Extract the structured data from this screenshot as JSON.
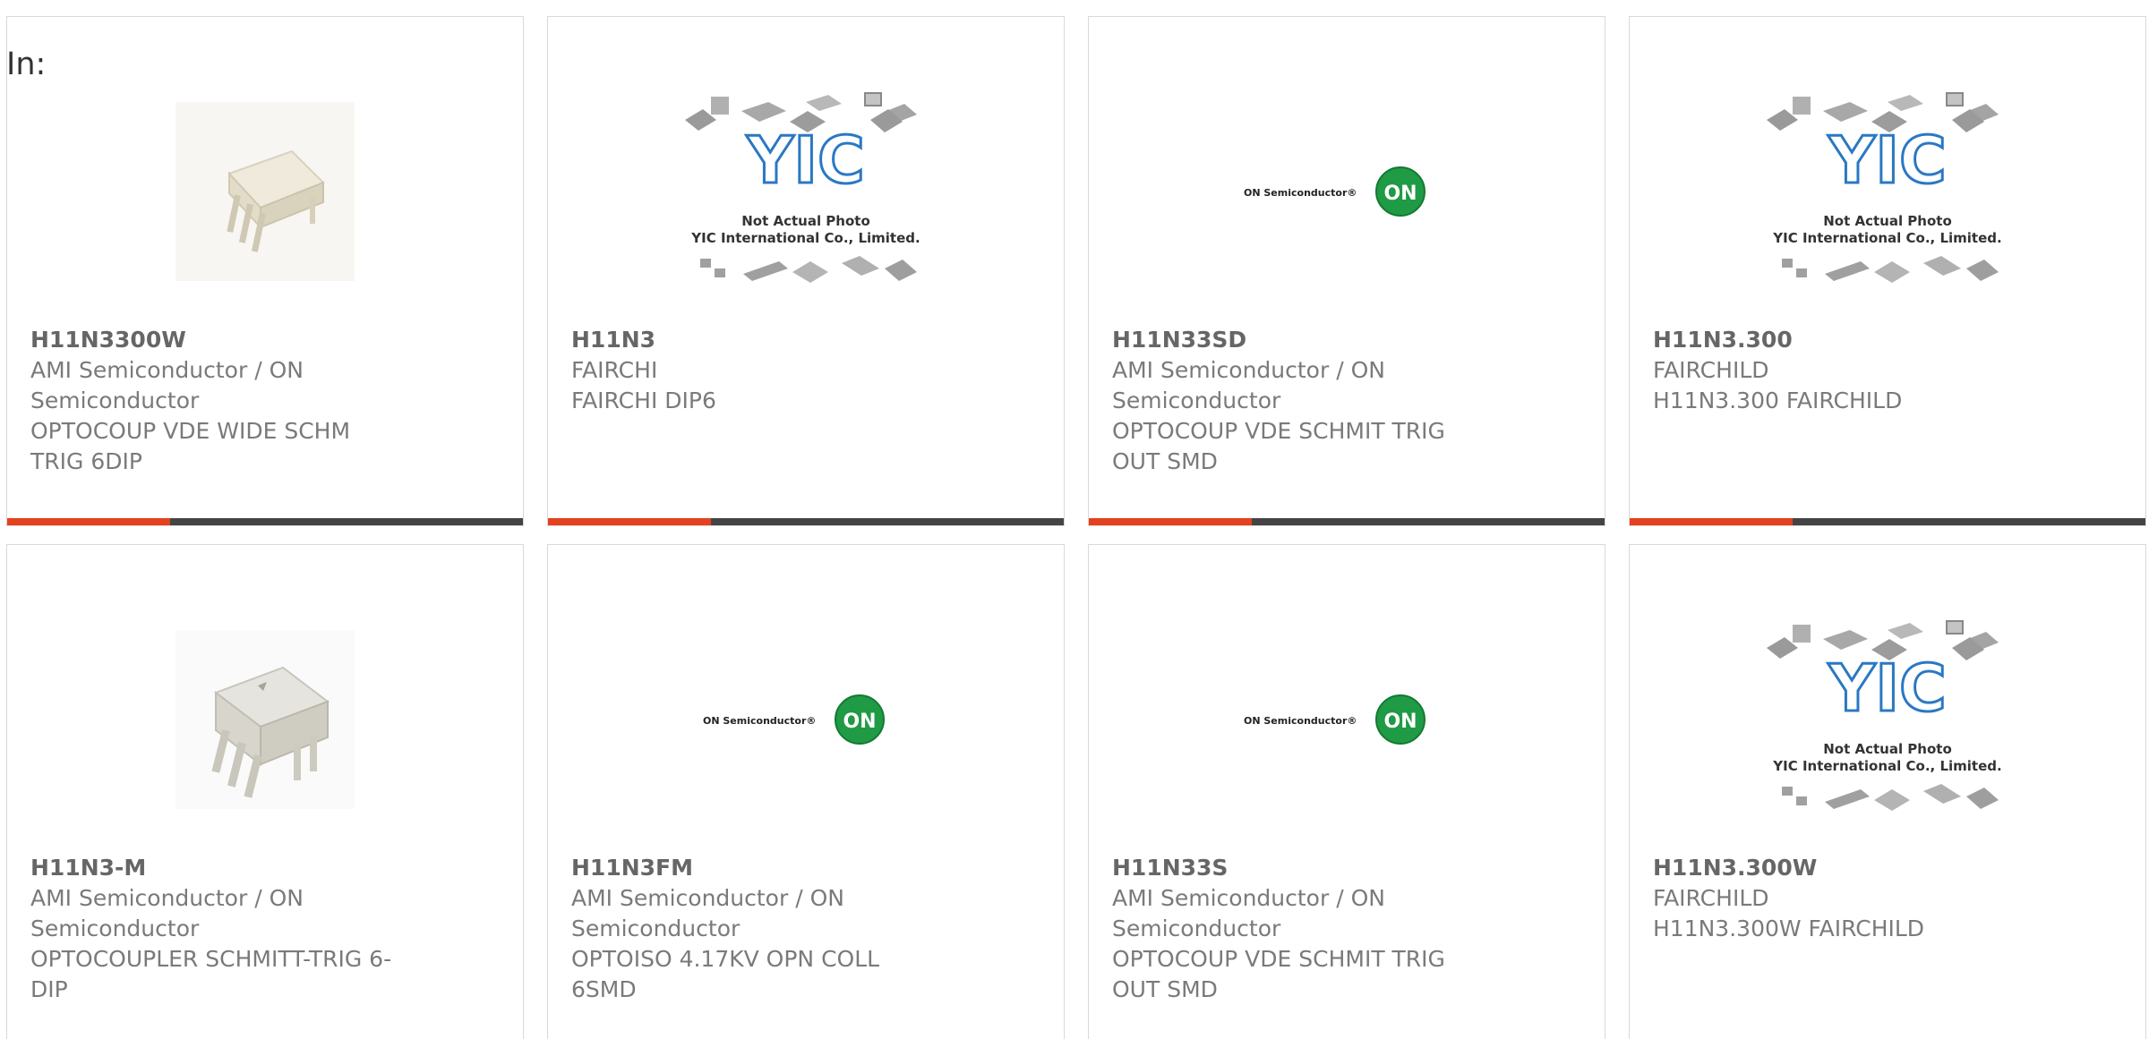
{
  "filter": {
    "label": "In:"
  },
  "colors": {
    "accent": "#e5411f",
    "bar": "#444444",
    "text": "#7a7a7a"
  },
  "placeholder_text": {
    "line1": "Not Actual Photo",
    "line2": "YIC International Co., Limited.",
    "logo": "YIC"
  },
  "on_logo_text": {
    "brand": "ON Semiconductor®",
    "badge": "ON"
  },
  "cards": [
    {
      "part": "H11N3300W",
      "maker": "AMI Semiconductor / ON Semiconductor",
      "desc": "OPTOCOUP VDE WIDE SCHM TRIG 6DIP",
      "image": "chip-photo-icon"
    },
    {
      "part": "H11N3",
      "maker": "FAIRCHI",
      "desc": "FAIRCHI DIP6",
      "image": "yic-placeholder-icon"
    },
    {
      "part": "H11N33SD",
      "maker": "AMI Semiconductor / ON Semiconductor",
      "desc": "OPTOCOUP VDE SCHMIT TRIG OUT SMD",
      "image": "on-semi-logo-icon"
    },
    {
      "part": "H11N3.300",
      "maker": "FAIRCHILD",
      "desc": "H11N3.300 FAIRCHILD",
      "image": "yic-placeholder-icon"
    },
    {
      "part": "H11N3-M",
      "maker": "AMI Semiconductor / ON Semiconductor",
      "desc": "OPTOCOUPLER SCHMITT-TRIG 6-DIP",
      "image": "chip-photo-icon"
    },
    {
      "part": "H11N3FM",
      "maker": "AMI Semiconductor / ON Semiconductor",
      "desc": "OPTOISO 4.17KV OPN COLL 6SMD",
      "image": "on-semi-logo-icon"
    },
    {
      "part": "H11N33S",
      "maker": "AMI Semiconductor / ON Semiconductor",
      "desc": "OPTOCOUP VDE SCHMIT TRIG OUT SMD",
      "image": "on-semi-logo-icon"
    },
    {
      "part": "H11N3.300W",
      "maker": "FAIRCHILD",
      "desc": "H11N3.300W FAIRCHILD",
      "image": "yic-placeholder-icon"
    }
  ]
}
